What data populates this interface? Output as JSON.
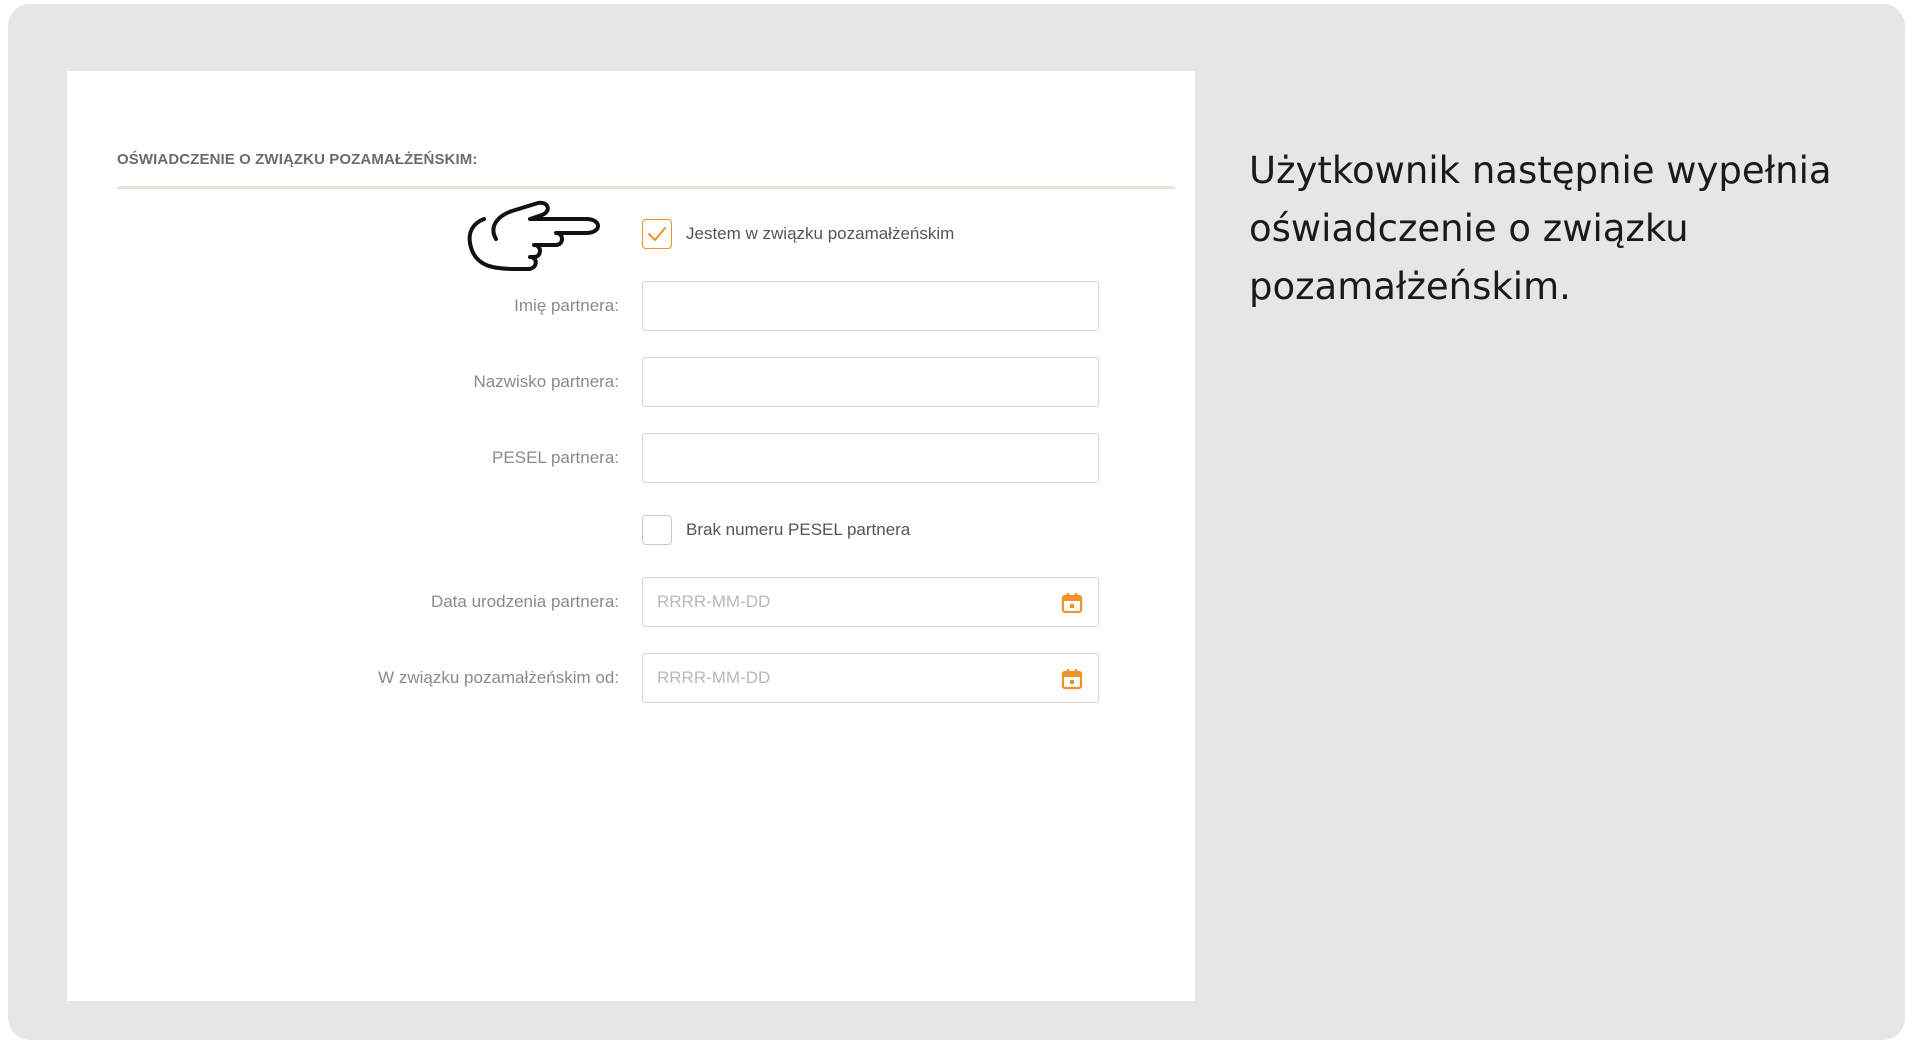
{
  "form": {
    "section_title": "OŚWIADCZENIE O ZWIĄZKU POZAMAŁŻEŃSKIM:",
    "relationship_checkbox": {
      "label": "Jestem w związku pozamałżeńskim",
      "checked": true
    },
    "fields": [
      {
        "label": "Imię partnera:",
        "value": "",
        "placeholder": ""
      },
      {
        "label": "Nazwisko partnera:",
        "value": "",
        "placeholder": ""
      },
      {
        "label": "PESEL partnera:",
        "value": "",
        "placeholder": ""
      }
    ],
    "no_pesel_checkbox": {
      "label": "Brak numeru PESEL partnera",
      "checked": false
    },
    "date_fields": [
      {
        "label": "Data urodzenia partnera:",
        "placeholder": "RRRR-MM-DD",
        "icon": "calendar-icon"
      },
      {
        "label": "W związku pozamałżeńskim od:",
        "placeholder": "RRRR-MM-DD",
        "icon": "calendar-icon"
      }
    ]
  },
  "pointer": {
    "icon": "pointing-hand-icon"
  },
  "description": "Użytkownik następnie wypełnia oświadczenie o związku pozamałżeńskim.",
  "colors": {
    "accent": "#f0922a",
    "divider": "#efe1d9",
    "background": "#e6e6e6"
  }
}
